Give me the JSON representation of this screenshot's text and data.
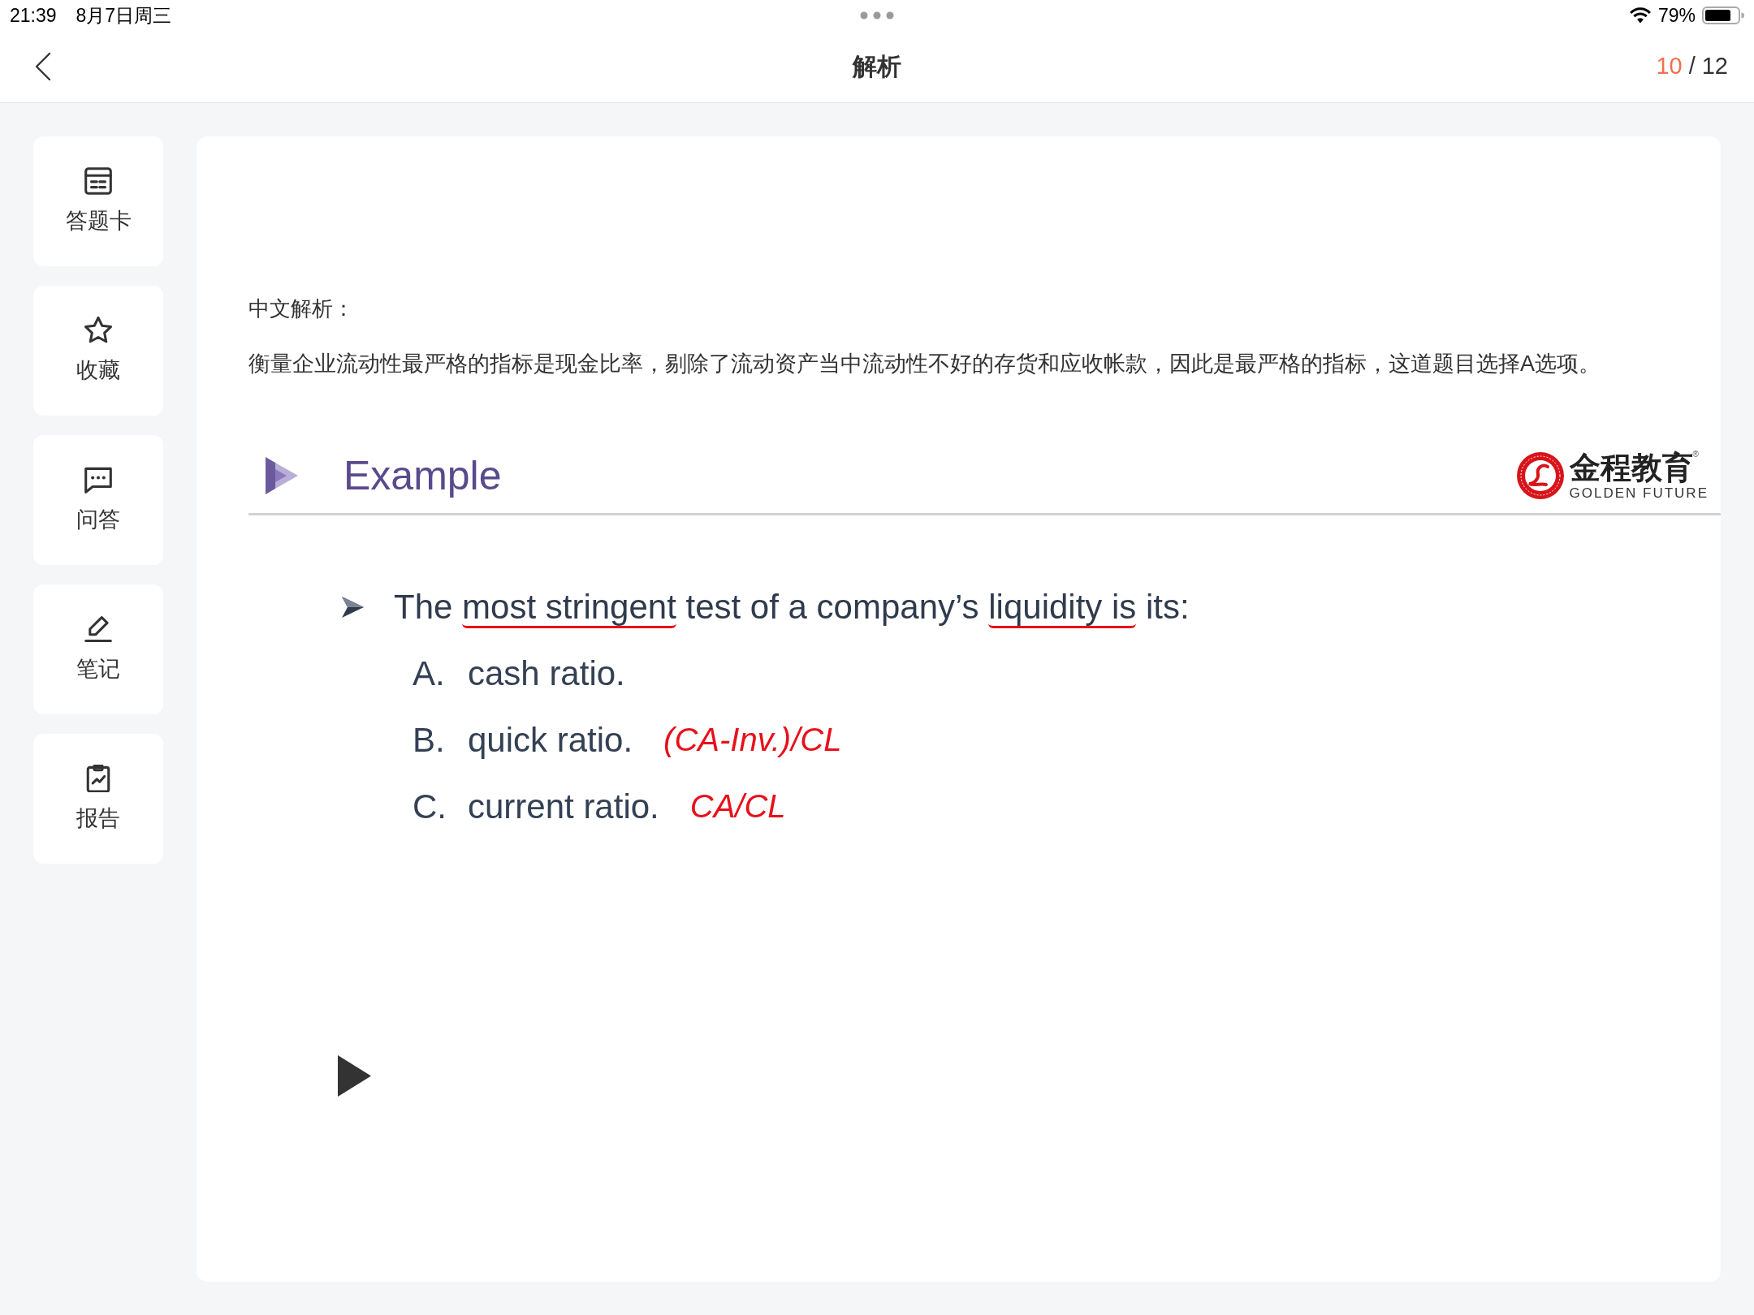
{
  "status_bar": {
    "time": "21:39",
    "date": "8月7日周三",
    "battery": "79%"
  },
  "nav": {
    "title": "解析",
    "counter": {
      "current": "10",
      "separator": "/",
      "total": "12"
    }
  },
  "sidebar": {
    "items": [
      {
        "label": "答题卡"
      },
      {
        "label": "收藏"
      },
      {
        "label": "问答"
      },
      {
        "label": "笔记"
      },
      {
        "label": "报告"
      }
    ]
  },
  "analysis": {
    "heading": "中文解析：",
    "text": "衡量企业流动性最严格的指标是现金比率，剔除了流动资产当中流动性不好的存货和应收帐款，因此是最严格的指标，这道题目选择A选项。"
  },
  "slide": {
    "title": "Example",
    "logo": {
      "name": "金程教育",
      "mark": "®",
      "tagline": "GOLDEN FUTURE"
    },
    "question": {
      "segments": [
        {
          "text": "The",
          "underlined": false
        },
        {
          "text": "most stringent",
          "underlined": true
        },
        {
          "text": "test of a company’s",
          "underlined": false
        },
        {
          "text": "liquidity is",
          "underlined": true
        },
        {
          "text": "its:",
          "underlined": false
        }
      ]
    },
    "options": [
      {
        "letter": "A.",
        "text": "cash ratio."
      },
      {
        "letter": "B.",
        "text": "quick ratio.",
        "note": "(CA-Inv.)/CL"
      },
      {
        "letter": "C.",
        "text": "current ratio.",
        "note": "CA/CL"
      }
    ]
  }
}
